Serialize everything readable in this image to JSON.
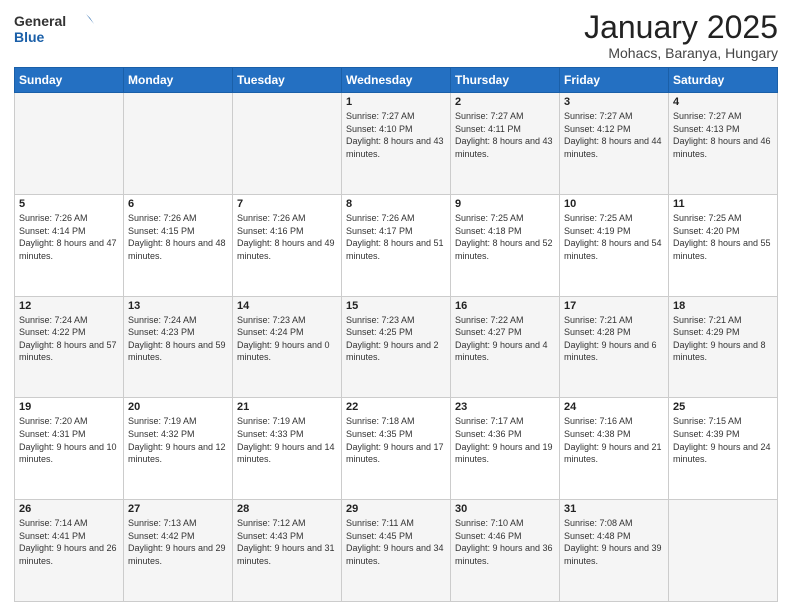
{
  "header": {
    "logo_general": "General",
    "logo_blue": "Blue",
    "month_title": "January 2025",
    "subtitle": "Mohacs, Baranya, Hungary"
  },
  "days_of_week": [
    "Sunday",
    "Monday",
    "Tuesday",
    "Wednesday",
    "Thursday",
    "Friday",
    "Saturday"
  ],
  "weeks": [
    [
      {
        "day": "",
        "info": ""
      },
      {
        "day": "",
        "info": ""
      },
      {
        "day": "",
        "info": ""
      },
      {
        "day": "1",
        "info": "Sunrise: 7:27 AM\nSunset: 4:10 PM\nDaylight: 8 hours and 43 minutes."
      },
      {
        "day": "2",
        "info": "Sunrise: 7:27 AM\nSunset: 4:11 PM\nDaylight: 8 hours and 43 minutes."
      },
      {
        "day": "3",
        "info": "Sunrise: 7:27 AM\nSunset: 4:12 PM\nDaylight: 8 hours and 44 minutes."
      },
      {
        "day": "4",
        "info": "Sunrise: 7:27 AM\nSunset: 4:13 PM\nDaylight: 8 hours and 46 minutes."
      }
    ],
    [
      {
        "day": "5",
        "info": "Sunrise: 7:26 AM\nSunset: 4:14 PM\nDaylight: 8 hours and 47 minutes."
      },
      {
        "day": "6",
        "info": "Sunrise: 7:26 AM\nSunset: 4:15 PM\nDaylight: 8 hours and 48 minutes."
      },
      {
        "day": "7",
        "info": "Sunrise: 7:26 AM\nSunset: 4:16 PM\nDaylight: 8 hours and 49 minutes."
      },
      {
        "day": "8",
        "info": "Sunrise: 7:26 AM\nSunset: 4:17 PM\nDaylight: 8 hours and 51 minutes."
      },
      {
        "day": "9",
        "info": "Sunrise: 7:25 AM\nSunset: 4:18 PM\nDaylight: 8 hours and 52 minutes."
      },
      {
        "day": "10",
        "info": "Sunrise: 7:25 AM\nSunset: 4:19 PM\nDaylight: 8 hours and 54 minutes."
      },
      {
        "day": "11",
        "info": "Sunrise: 7:25 AM\nSunset: 4:20 PM\nDaylight: 8 hours and 55 minutes."
      }
    ],
    [
      {
        "day": "12",
        "info": "Sunrise: 7:24 AM\nSunset: 4:22 PM\nDaylight: 8 hours and 57 minutes."
      },
      {
        "day": "13",
        "info": "Sunrise: 7:24 AM\nSunset: 4:23 PM\nDaylight: 8 hours and 59 minutes."
      },
      {
        "day": "14",
        "info": "Sunrise: 7:23 AM\nSunset: 4:24 PM\nDaylight: 9 hours and 0 minutes."
      },
      {
        "day": "15",
        "info": "Sunrise: 7:23 AM\nSunset: 4:25 PM\nDaylight: 9 hours and 2 minutes."
      },
      {
        "day": "16",
        "info": "Sunrise: 7:22 AM\nSunset: 4:27 PM\nDaylight: 9 hours and 4 minutes."
      },
      {
        "day": "17",
        "info": "Sunrise: 7:21 AM\nSunset: 4:28 PM\nDaylight: 9 hours and 6 minutes."
      },
      {
        "day": "18",
        "info": "Sunrise: 7:21 AM\nSunset: 4:29 PM\nDaylight: 9 hours and 8 minutes."
      }
    ],
    [
      {
        "day": "19",
        "info": "Sunrise: 7:20 AM\nSunset: 4:31 PM\nDaylight: 9 hours and 10 minutes."
      },
      {
        "day": "20",
        "info": "Sunrise: 7:19 AM\nSunset: 4:32 PM\nDaylight: 9 hours and 12 minutes."
      },
      {
        "day": "21",
        "info": "Sunrise: 7:19 AM\nSunset: 4:33 PM\nDaylight: 9 hours and 14 minutes."
      },
      {
        "day": "22",
        "info": "Sunrise: 7:18 AM\nSunset: 4:35 PM\nDaylight: 9 hours and 17 minutes."
      },
      {
        "day": "23",
        "info": "Sunrise: 7:17 AM\nSunset: 4:36 PM\nDaylight: 9 hours and 19 minutes."
      },
      {
        "day": "24",
        "info": "Sunrise: 7:16 AM\nSunset: 4:38 PM\nDaylight: 9 hours and 21 minutes."
      },
      {
        "day": "25",
        "info": "Sunrise: 7:15 AM\nSunset: 4:39 PM\nDaylight: 9 hours and 24 minutes."
      }
    ],
    [
      {
        "day": "26",
        "info": "Sunrise: 7:14 AM\nSunset: 4:41 PM\nDaylight: 9 hours and 26 minutes."
      },
      {
        "day": "27",
        "info": "Sunrise: 7:13 AM\nSunset: 4:42 PM\nDaylight: 9 hours and 29 minutes."
      },
      {
        "day": "28",
        "info": "Sunrise: 7:12 AM\nSunset: 4:43 PM\nDaylight: 9 hours and 31 minutes."
      },
      {
        "day": "29",
        "info": "Sunrise: 7:11 AM\nSunset: 4:45 PM\nDaylight: 9 hours and 34 minutes."
      },
      {
        "day": "30",
        "info": "Sunrise: 7:10 AM\nSunset: 4:46 PM\nDaylight: 9 hours and 36 minutes."
      },
      {
        "day": "31",
        "info": "Sunrise: 7:08 AM\nSunset: 4:48 PM\nDaylight: 9 hours and 39 minutes."
      },
      {
        "day": "",
        "info": ""
      }
    ]
  ]
}
